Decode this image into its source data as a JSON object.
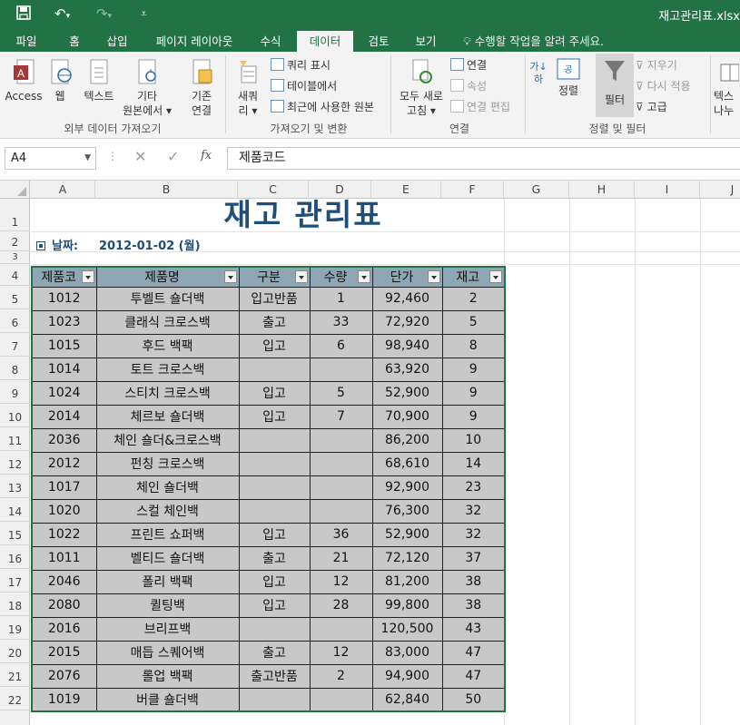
{
  "titlebar": {
    "file_name": "재고관리표.xlsx",
    "save_icon": "save-icon",
    "undo_icon": "undo-icon",
    "redo_icon": "redo-icon",
    "customize_icon": "customize-qat-icon"
  },
  "ribbon_tabs": [
    "파일",
    "홈",
    "삽입",
    "페이지 레이아웃",
    "수식",
    "데이터",
    "검토",
    "보기"
  ],
  "active_tab": "데이터",
  "tell_me": "수행할 작업을 알려 주세요.",
  "groups": {
    "external": {
      "label": "외부 데이터 가져오기",
      "access": "Access",
      "web": "웹",
      "text": "텍스트",
      "other_line1": "기타",
      "other_line2": "원본에서 ▾",
      "existing_line1": "기존",
      "existing_line2": "연결"
    },
    "get_transform": {
      "label": "가져오기 및 변환",
      "new_query_line1": "새쿼",
      "new_query_line2": "리 ▾",
      "show_queries": "쿼리 표시",
      "from_table": "테이블에서",
      "recent_sources": "최근에 사용한 원본"
    },
    "connections": {
      "label": "연결",
      "refresh_all_line1": "모두 새로",
      "refresh_all_line2": "고침 ▾",
      "connections": "연결",
      "properties": "속성",
      "edit_links": "연결 편집"
    },
    "sort_filter": {
      "label": "정렬 및 필터",
      "sort": "정렬",
      "filter": "필터",
      "clear": "지우기",
      "reapply": "다시 적용",
      "advanced": "고급"
    },
    "data_tools": {
      "text_line1": "텍스",
      "text_line2": "나누"
    }
  },
  "formula_bar": {
    "name_box": "A4",
    "fx": "fx",
    "content": "제품코드"
  },
  "columns": [
    "A",
    "B",
    "C",
    "D",
    "E",
    "F",
    "G",
    "H",
    "I",
    "J"
  ],
  "rows": [
    "1",
    "2",
    "3",
    "4",
    "5",
    "6",
    "7",
    "8",
    "9",
    "10",
    "11",
    "12",
    "13",
    "14",
    "15",
    "16",
    "17",
    "18",
    "19",
    "20",
    "21",
    "22"
  ],
  "sheet": {
    "title": "재고 관리표",
    "date_label": "날짜:",
    "date_value": "2012-01-02 (월)",
    "headers": [
      "제품코",
      "제품명",
      "구분",
      "수량",
      "단가",
      "재고"
    ],
    "data": [
      [
        "1012",
        "투벨트 숄더백",
        "입고반품",
        "1",
        "92,460",
        "2"
      ],
      [
        "1023",
        "클래식 크로스백",
        "출고",
        "33",
        "72,920",
        "5"
      ],
      [
        "1015",
        "후드 백팩",
        "입고",
        "6",
        "98,940",
        "8"
      ],
      [
        "1014",
        "토트 크로스백",
        "",
        "",
        "63,920",
        "9"
      ],
      [
        "1024",
        "스티치 크로스백",
        "입고",
        "5",
        "52,900",
        "9"
      ],
      [
        "2014",
        "체르보 숄더백",
        "입고",
        "7",
        "70,900",
        "9"
      ],
      [
        "2036",
        "체인 숄더&크로스백",
        "",
        "",
        "86,200",
        "10"
      ],
      [
        "2012",
        "펀칭 크로스백",
        "",
        "",
        "68,610",
        "14"
      ],
      [
        "1017",
        "체인 숄더백",
        "",
        "",
        "92,900",
        "23"
      ],
      [
        "1020",
        "스컬 체인백",
        "",
        "",
        "76,300",
        "32"
      ],
      [
        "1022",
        "프린트 쇼퍼백",
        "입고",
        "36",
        "52,900",
        "32"
      ],
      [
        "1011",
        "벨티드 숄더백",
        "출고",
        "21",
        "72,120",
        "37"
      ],
      [
        "2046",
        "폴리 백팩",
        "입고",
        "12",
        "81,200",
        "38"
      ],
      [
        "2080",
        "퀼팅백",
        "입고",
        "28",
        "99,800",
        "38"
      ],
      [
        "2016",
        "브리프백",
        "",
        "",
        "120,500",
        "43"
      ],
      [
        "2015",
        "매듭 스퀘어백",
        "출고",
        "12",
        "83,000",
        "47"
      ],
      [
        "2076",
        "롤업 백팩",
        "출고반품",
        "2",
        "94,900",
        "47"
      ],
      [
        "1019",
        "버클 숄더백",
        "",
        "",
        "62,840",
        "50"
      ]
    ]
  },
  "colors": {
    "excel_green": "#217346",
    "title_blue": "#1f4e79",
    "header_fill": "#8fa6b4",
    "cell_fill": "#c8c8c8"
  }
}
